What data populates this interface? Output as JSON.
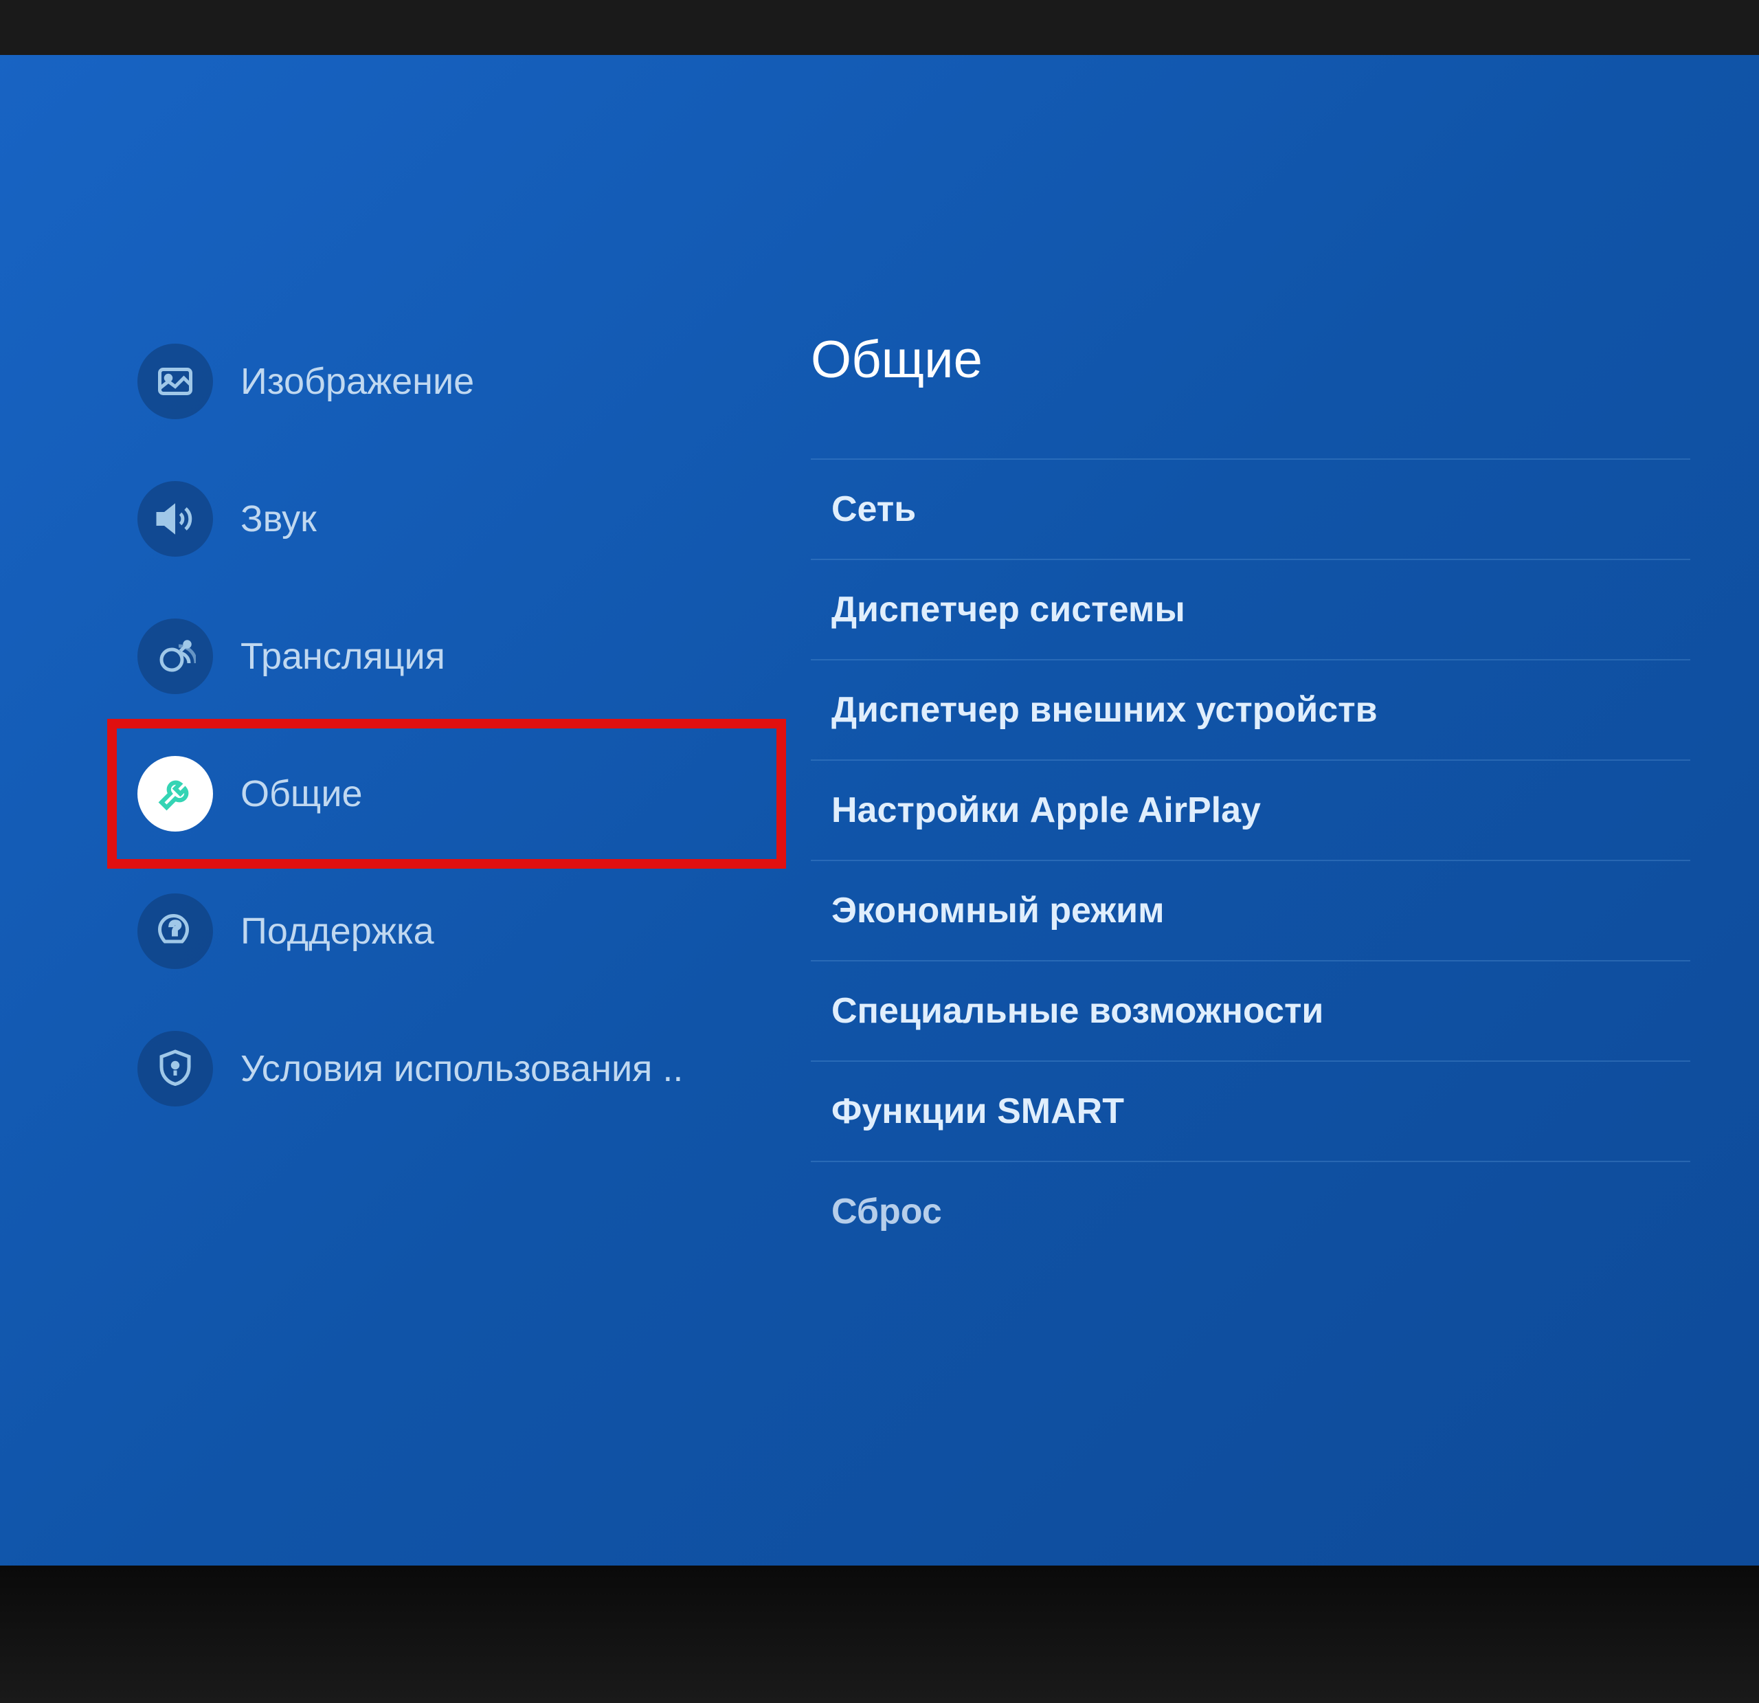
{
  "sidebar": {
    "items": [
      {
        "id": "picture",
        "label": "Изображение",
        "icon": "picture-icon",
        "selected": false
      },
      {
        "id": "sound",
        "label": "Звук",
        "icon": "sound-icon",
        "selected": false
      },
      {
        "id": "broadcast",
        "label": "Трансляция",
        "icon": "satellite-icon",
        "selected": false
      },
      {
        "id": "general",
        "label": "Общие",
        "icon": "wrench-icon",
        "selected": true,
        "highlighted": true
      },
      {
        "id": "support",
        "label": "Поддержка",
        "icon": "support-icon",
        "selected": false
      },
      {
        "id": "terms",
        "label": "Условия использования ..",
        "icon": "shield-icon",
        "selected": false
      }
    ]
  },
  "content": {
    "title": "Общие",
    "items": [
      {
        "label": "Сеть"
      },
      {
        "label": "Диспетчер системы"
      },
      {
        "label": "Диспетчер внешних устройств"
      },
      {
        "label": "Настройки Apple AirPlay"
      },
      {
        "label": "Экономный режим"
      },
      {
        "label": "Специальные возможности"
      },
      {
        "label": "Функции SMART"
      },
      {
        "label": "Сброс",
        "cutoff": true
      }
    ]
  },
  "colors": {
    "accent": "#34d4b4",
    "highlight_box": "#e01010",
    "background_gradient_start": "#1864c4",
    "background_gradient_end": "#0e4a98"
  }
}
